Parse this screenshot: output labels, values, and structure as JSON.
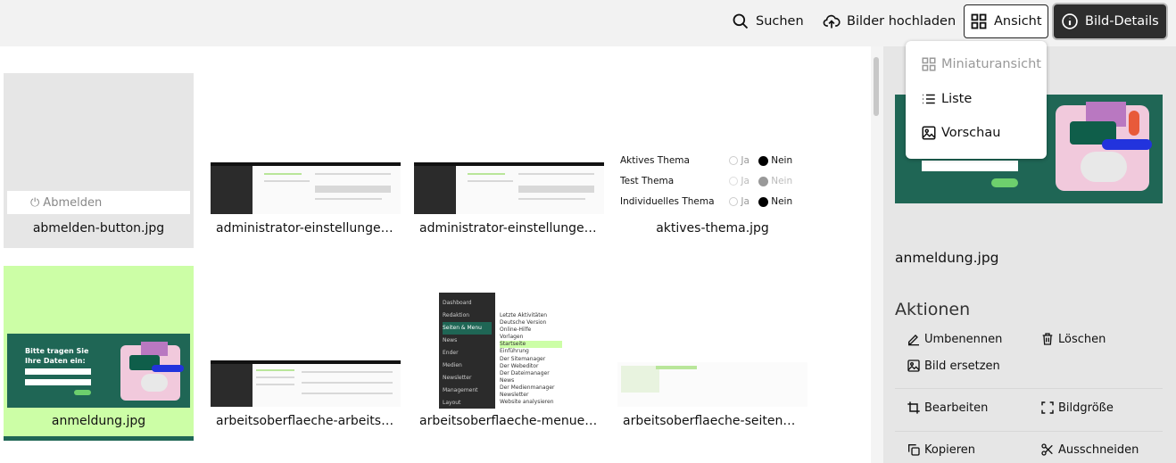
{
  "toolbar": {
    "search": "Suchen",
    "upload": "Bilder hochladen",
    "view": "Ansicht",
    "details": "Bild-Details"
  },
  "view_menu": {
    "items": [
      {
        "label": "Miniaturansicht",
        "disabled": true
      },
      {
        "label": "Liste"
      },
      {
        "label": "Vorschau"
      }
    ]
  },
  "files": [
    {
      "name": "abmelden-button.jpg",
      "thumb_text": "Abmelden"
    },
    {
      "name": "administrator-einstellungen..."
    },
    {
      "name": "administrator-einstellungen..."
    },
    {
      "name": "aktives-thema.jpg",
      "thumb_rows": [
        [
          "Aktives Thema",
          "Ja",
          "Nein"
        ],
        [
          "Test Thema",
          "Ja",
          "Nein"
        ],
        [
          "Individuelles Thema",
          "Ja",
          "Nein"
        ]
      ]
    },
    {
      "name": "anmeldung.jpg",
      "selected": true,
      "thumb_text": "Bitte tragen Sie Ihre Daten ein:"
    },
    {
      "name": "arbeitsoberflaeche-arbeits-..."
    },
    {
      "name": "arbeitsoberflaeche-menueb...",
      "thumb_menu": [
        "Dashboard",
        "Redaktion",
        "Seiten & Menu",
        "News",
        "Ender",
        "Medien",
        "Newsletter",
        "Management",
        "Layout"
      ],
      "thumb_tree": [
        "Letzte Aktivitäten",
        "Deutsche Version",
        "Online-Hilfe",
        "Vorlagen",
        "Startseite",
        "Einführung",
        "Der Sitemanager",
        "Der Webeditor",
        "Der Dateimanager",
        "News",
        "Der Medienmanager",
        "Newsletter",
        "Website analysieren"
      ]
    },
    {
      "name": "arbeitsoberflaeche-seitenei..."
    }
  ],
  "details": {
    "name": "anmeldung.jpg",
    "actions_title": "Aktionen",
    "actions": {
      "rename": "Umbenennen",
      "delete": "Löschen",
      "replace": "Bild ersetzen",
      "edit": "Bearbeiten",
      "resize": "Bildgröße",
      "copy": "Kopieren",
      "cut": "Ausschneiden"
    }
  },
  "colors": {
    "selected_bg": "#ccfea6",
    "dark_button": "#2d2d2d",
    "preview_green": "#1f6655"
  }
}
